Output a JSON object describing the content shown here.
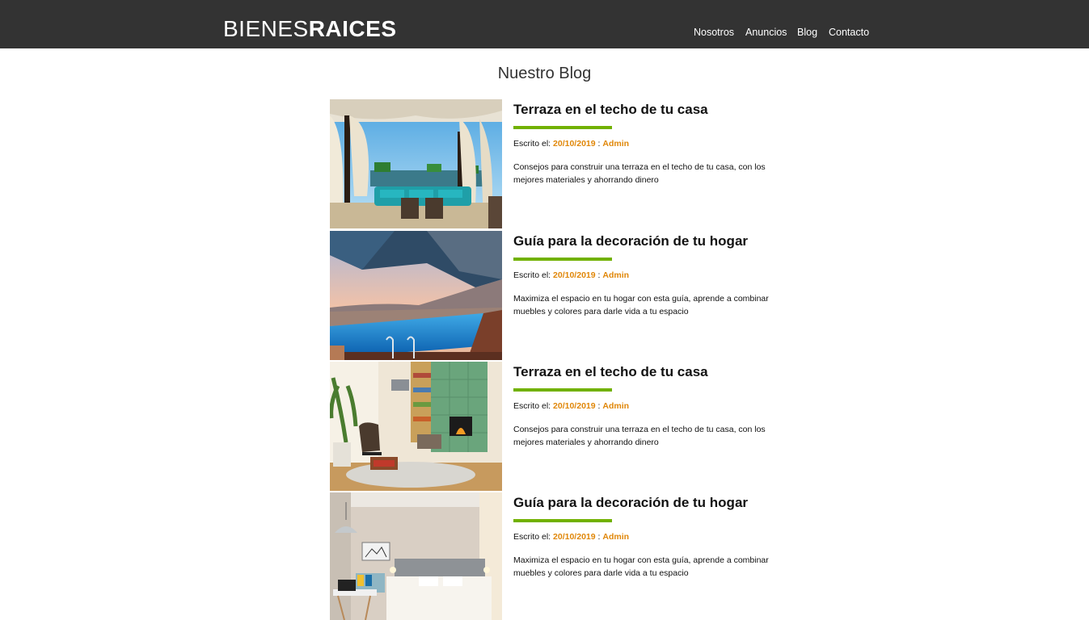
{
  "header": {
    "logo_light": "BIENES",
    "logo_bold": "RAICES",
    "nav": [
      "Nosotros",
      "Anuncios",
      "Blog",
      "Contacto"
    ]
  },
  "main": {
    "title": "Nuestro Blog",
    "entries": [
      {
        "title": "Terraza en el techo de tu casa",
        "meta_label": "Escrito el:",
        "date": "20/10/2019",
        "separator": ":",
        "author": "Admin",
        "description": "Consejos para construir una terraza en el techo de tu casa, con los mejores materiales y ahorrando dinero",
        "image": "rooftop-terrace-photo"
      },
      {
        "title": "Guía para la decoración de tu hogar",
        "meta_label": "Escrito el:",
        "date": "20/10/2019",
        "separator": ":",
        "author": "Admin",
        "description": "Maximiza el espacio en tu hogar con esta guía, aprende a combinar muebles y colores para darle vida a tu espacio",
        "image": "infinity-pool-photo"
      },
      {
        "title": "Terraza en el techo de tu casa",
        "meta_label": "Escrito el:",
        "date": "20/10/2019",
        "separator": ":",
        "author": "Admin",
        "description": "Consejos para construir una terraza en el techo de tu casa, con los mejores materiales y ahorrando dinero",
        "image": "living-room-photo"
      },
      {
        "title": "Guía para la decoración de tu hogar",
        "meta_label": "Escrito el:",
        "date": "20/10/2019",
        "separator": ":",
        "author": "Admin",
        "description": "Maximiza el espacio en tu hogar con esta guía, aprende a combinar muebles y colores para darle vida a tu espacio",
        "image": "bedroom-photo"
      }
    ]
  },
  "colors": {
    "header_bg": "#333333",
    "accent_green": "#71b100",
    "accent_orange": "#e08709"
  }
}
